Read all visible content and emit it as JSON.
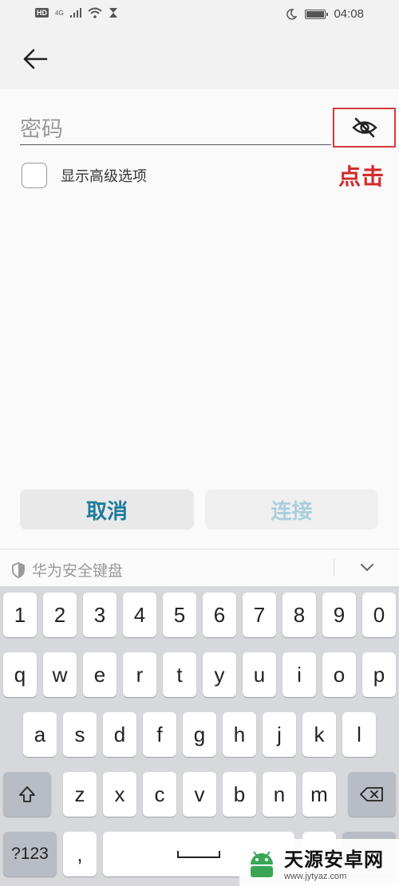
{
  "status_bar": {
    "hd_badge": "HD",
    "network": "4G",
    "time": "04:08"
  },
  "form": {
    "password_placeholder": "密码",
    "advanced_options_label": "显示高级选项",
    "annotation": "点击"
  },
  "buttons": {
    "cancel_label": "取消",
    "connect_label": "连接"
  },
  "keyboard": {
    "title": "华为安全键盘",
    "row_numbers": [
      "1",
      "2",
      "3",
      "4",
      "5",
      "6",
      "7",
      "8",
      "9",
      "0"
    ],
    "row_q": [
      "q",
      "w",
      "e",
      "r",
      "t",
      "y",
      "u",
      "i",
      "o",
      "p"
    ],
    "row_a": [
      "a",
      "s",
      "d",
      "f",
      "g",
      "h",
      "j",
      "k",
      "l"
    ],
    "row_z": [
      "z",
      "x",
      "c",
      "v",
      "b",
      "n",
      "m"
    ],
    "symbols_key": "?123",
    "comma_key": ","
  },
  "watermark": {
    "name": "天源安卓网",
    "url": "www.jytyaz.com"
  },
  "colors": {
    "accent": "#1c7a9c",
    "disabled_accent": "#a9cfdc",
    "annotation_red": "#d42b2b"
  }
}
